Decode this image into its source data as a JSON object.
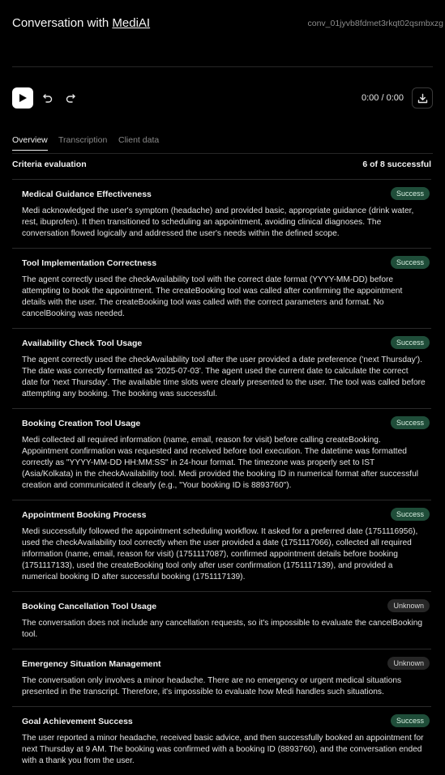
{
  "header": {
    "title_prefix": "Conversation with ",
    "agent_name": "MediAI",
    "conversation_id": "conv_01jyvb8fdmet3rkqt02qsmbxzg"
  },
  "player": {
    "time": "0:00 / 0:00"
  },
  "tabs": [
    {
      "label": "Overview",
      "active": true
    },
    {
      "label": "Transcription",
      "active": false
    },
    {
      "label": "Client data",
      "active": false
    }
  ],
  "criteria": {
    "heading": "Criteria evaluation",
    "summary": "6 of 8 successful",
    "items": [
      {
        "title": "Medical Guidance Effectiveness",
        "status": "Success",
        "body": "Medi acknowledged the user's symptom (headache) and provided basic, appropriate guidance (drink water, rest, ibuprofen). It then transitioned to scheduling an appointment, avoiding clinical diagnoses. The conversation flowed logically and addressed the user's needs within the defined scope."
      },
      {
        "title": "Tool Implementation Correctness",
        "status": "Success",
        "body": "The agent correctly used the checkAvailability tool with the correct date format (YYYY-MM-DD) before attempting to book the appointment. The createBooking tool was called after confirming the appointment details with the user. The createBooking tool was called with the correct parameters and format. No cancelBooking was needed."
      },
      {
        "title": "Availability Check Tool Usage",
        "status": "Success",
        "body": "The agent correctly used the checkAvailability tool after the user provided a date preference ('next Thursday'). The date was correctly formatted as '2025-07-03'. The agent used the current date to calculate the correct date for 'next Thursday'. The available time slots were clearly presented to the user. The tool was called before attempting any booking. The booking was successful."
      },
      {
        "title": "Booking Creation Tool Usage",
        "status": "Success",
        "body": "Medi collected all required information (name, email, reason for visit) before calling createBooking. Appointment confirmation was requested and received before tool execution. The datetime was formatted correctly as \"YYYY-MM-DD HH:MM:SS\" in 24-hour format. The timezone was properly set to IST (Asia/Kolkata) in the checkAvailability tool. Medi provided the booking ID in numerical format after successful creation and communicated it clearly (e.g., \"Your booking ID is 8893760\")."
      },
      {
        "title": "Appointment Booking Process",
        "status": "Success",
        "body": "Medi successfully followed the appointment scheduling workflow. It asked for a preferred date (1751116956), used the checkAvailability tool correctly when the user provided a date (1751117066), collected all required information (name, email, reason for visit) (1751117087), confirmed appointment details before booking (1751117133), used the createBooking tool only after user confirmation (1751117139), and provided a numerical booking ID after successful booking (1751117139)."
      },
      {
        "title": "Booking Cancellation Tool Usage",
        "status": "Unknown",
        "body": "The conversation does not include any cancellation requests, so it's impossible to evaluate the cancelBooking tool."
      },
      {
        "title": "Emergency Situation Management",
        "status": "Unknown",
        "body": "The conversation only involves a minor headache. There are no emergency or urgent medical situations presented in the transcript. Therefore, it's impossible to evaluate how Medi handles such situations."
      },
      {
        "title": "Goal Achievement Success",
        "status": "Success",
        "body": "The user reported a minor headache, received basic advice, and then successfully booked an appointment for next Thursday at 9 AM. The booking was confirmed with a booking ID (8893760), and the conversation ended with a thank you from the user."
      }
    ]
  },
  "colors": {
    "background": "#000000",
    "success_badge": "#1f4d39",
    "unknown_badge": "#262626"
  },
  "icons": {
    "play": "play-icon",
    "undo": "rewind-icon",
    "redo": "forward-icon",
    "download": "download-icon"
  }
}
